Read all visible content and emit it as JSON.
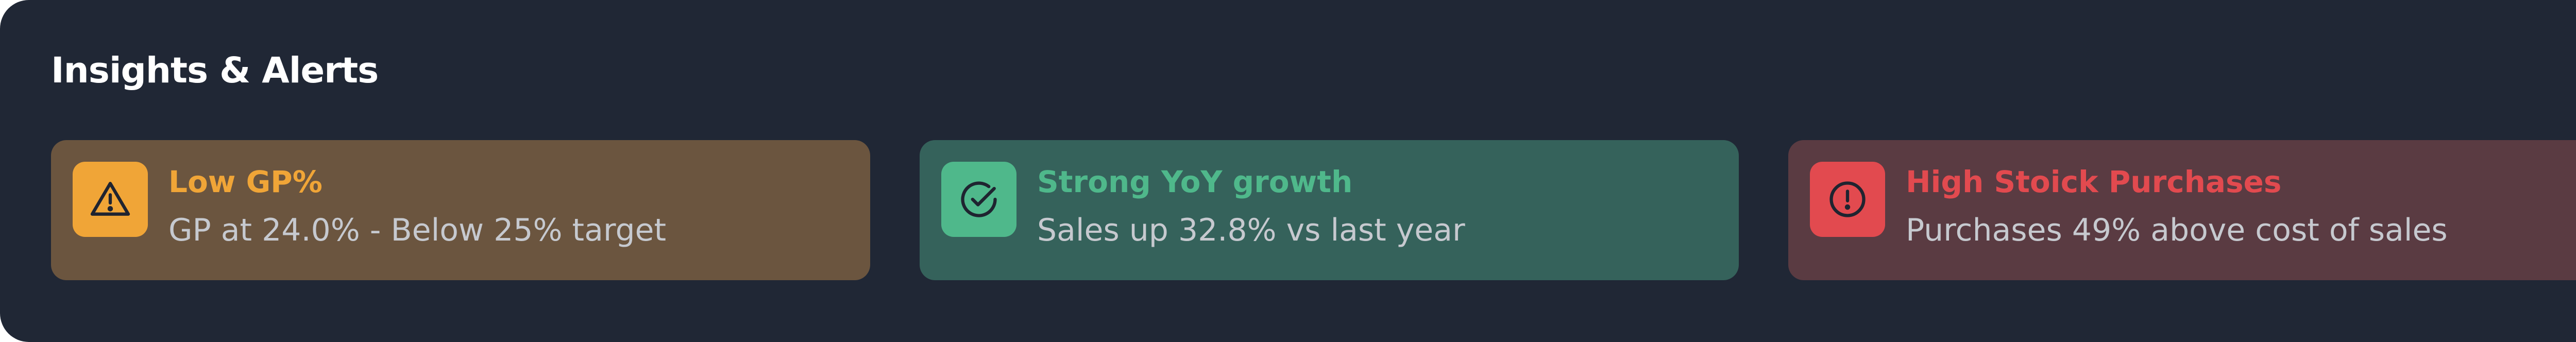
{
  "panel": {
    "title": "Insights & Alerts"
  },
  "alerts": [
    {
      "type": "warning",
      "icon": "warning-triangle-icon",
      "title": "Low GP%",
      "text": "GP at 24.0% - Below 25% target",
      "accent_color": "#f0a537",
      "card_color": "#6b553f"
    },
    {
      "type": "success",
      "icon": "check-circle-icon",
      "title": "Strong YoY growth",
      "text": "Sales up 32.8% vs last year",
      "accent_color": "#4fb88b",
      "card_color": "#35625b"
    },
    {
      "type": "danger",
      "icon": "exclamation-circle-icon",
      "title": "High Stoick Purchases",
      "text": "Purchases 49% above cost of sales",
      "accent_color": "#e24a4f",
      "card_color": "#5a3b42"
    }
  ],
  "colors": {
    "panel_background": "#202735",
    "title_text": "#ffffff",
    "body_text": "#c6c9cf"
  }
}
